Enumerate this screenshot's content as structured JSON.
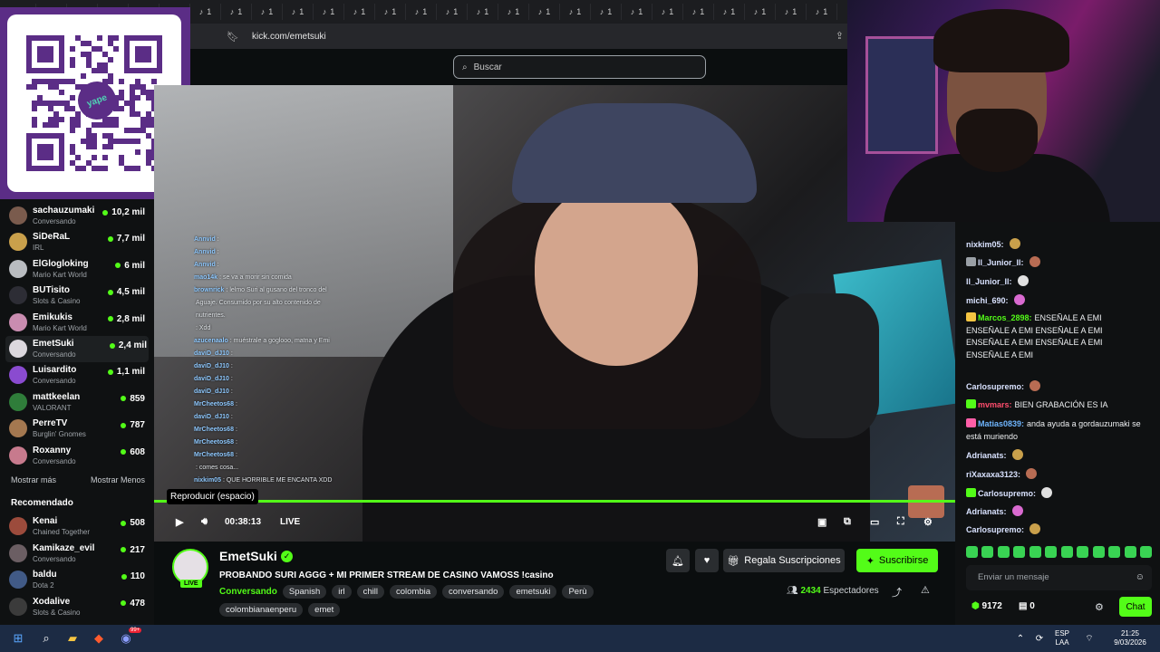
{
  "browser": {
    "url": "kick.com/emetsuki",
    "tab_icon_glyph": "♪",
    "tab_count_text": "1"
  },
  "header": {
    "search_placeholder": "Buscar"
  },
  "qr": {
    "brand": "yape"
  },
  "sidebar": {
    "following": [
      {
        "name": "sachauzumaki",
        "category": "Conversando",
        "viewers": "10,2 mil",
        "color": "#7a5b4d"
      },
      {
        "name": "SiDeRaL",
        "category": "IRL",
        "viewers": "7,7 mil",
        "color": "#c9a04b"
      },
      {
        "name": "ElGlogloking",
        "category": "Mario Kart World",
        "viewers": "6 mil",
        "color": "#b9bcc0"
      },
      {
        "name": "BUTisito",
        "category": "Slots & Casino",
        "viewers": "4,5 mil",
        "color": "#2d2d35"
      },
      {
        "name": "Emikukis",
        "category": "Mario Kart World",
        "viewers": "2,8 mil",
        "color": "#c98cb0"
      },
      {
        "name": "EmetSuki",
        "category": "Conversando",
        "viewers": "2,4 mil",
        "color": "#dcd8de"
      },
      {
        "name": "Luisardito",
        "category": "Conversando",
        "viewers": "1,1 mil",
        "color": "#8a4bd0"
      },
      {
        "name": "mattkeelan",
        "category": "VALORANT",
        "viewers": "859",
        "color": "#2f7d3a"
      },
      {
        "name": "PerreTV",
        "category": "Burglin' Gnomes",
        "viewers": "787",
        "color": "#a47850"
      },
      {
        "name": "Roxanny",
        "category": "Conversando",
        "viewers": "608",
        "color": "#c77a8d"
      }
    ],
    "show_more": "Mostrar más",
    "show_less": "Mostrar Menos",
    "recommended_title": "Recomendado",
    "recommended": [
      {
        "name": "Kenai",
        "category": "Chained Together",
        "viewers": "508",
        "color": "#9c4b3c"
      },
      {
        "name": "Kamikaze_evil",
        "category": "Conversando",
        "viewers": "217",
        "color": "#6b5e63"
      },
      {
        "name": "baldu",
        "category": "Dota 2",
        "viewers": "110",
        "color": "#415a86"
      },
      {
        "name": "Xodalive",
        "category": "Slots & Casino",
        "viewers": "478",
        "color": "#3b3b3b"
      }
    ]
  },
  "video_chat": [
    {
      "user": "Annvid",
      "text": ":"
    },
    {
      "user": "Annvid",
      "text": ":"
    },
    {
      "user": "Annvid",
      "text": ":"
    },
    {
      "user": "mao14k",
      "text": ": se va a morir sin comida"
    },
    {
      "user": "brownrick",
      "text": ": lelmo Suri al gusano del tronco del"
    },
    {
      "user": "",
      "text": "Aguaje. Consumido por su alto contenido de"
    },
    {
      "user": "",
      "text": "nutrientes."
    },
    {
      "user": "",
      "text": ": Xdd"
    },
    {
      "user": "azucenaalo",
      "text": ": muéstrale a goglooo, matna y Emi"
    },
    {
      "user": "daviD_dJ10",
      "text": ":"
    },
    {
      "user": "daviD_dJ10",
      "text": ":"
    },
    {
      "user": "daviD_dJ10",
      "text": ":"
    },
    {
      "user": "daviD_dJ10",
      "text": ":"
    },
    {
      "user": "MrCheetos68",
      "text": ":"
    },
    {
      "user": "daviD_dJ10",
      "text": ":"
    },
    {
      "user": "MrCheetos68",
      "text": ":"
    },
    {
      "user": "MrCheetos68",
      "text": ":"
    },
    {
      "user": "MrCheetos68",
      "text": ":"
    },
    {
      "user": "",
      "text": ": comes cosa..."
    },
    {
      "user": "nixkim05",
      "text": ": QUE HORRIBLE ME ENCANTA XDD"
    }
  ],
  "player": {
    "tooltip": "Reproducir (espacio)",
    "time": "00:38:13",
    "live": "LIVE",
    "progress_pct": 100
  },
  "channel": {
    "name": "EmetSuki",
    "live_badge": "LIVE",
    "title": "PROBANDO SURI AGGG + MI PRIMER STREAM DE CASINO VAMOSS !casino",
    "category": "Conversando",
    "tags": [
      "Spanish",
      "irl",
      "chill",
      "colombia",
      "conversando",
      "emetsuki",
      "Perù"
    ],
    "tags2": [
      "colombianaenperu",
      "emet"
    ],
    "gift_label": "Regala Suscripciones",
    "subscribe_label": "Suscribirse",
    "viewers": "2434",
    "viewers_label": "Espectadores"
  },
  "chat": {
    "messages": [
      {
        "user": "nixkim05:",
        "text": ""
      },
      {
        "user": "Il_Junior_Il:",
        "text": ""
      },
      {
        "user": "Il_Junior_Il:",
        "text": ""
      },
      {
        "user": "michi_690:",
        "text": ""
      },
      {
        "user": "Marcos_2898:",
        "text": "ENSEÑALE A EMI ENSEÑALE A EMI ENSEÑALE A EMI ENSEÑALE A EMI ENSEÑALE A EMI ENSEÑALE A EMI"
      },
      {
        "user": "Carlosupremo:",
        "text": ""
      },
      {
        "user": "mvmars:",
        "text": "BIEN GRABACIÓN ES IA"
      },
      {
        "user": "Matias0839:",
        "text": "anda ayuda a gordauzumaki se está muriendo"
      },
      {
        "user": "Adrianats:",
        "text": ""
      },
      {
        "user": "riXaxaxa3123:",
        "text": ""
      },
      {
        "user": "Carlosupremo:",
        "text": ""
      },
      {
        "user": "Adrianats:",
        "text": ""
      },
      {
        "user": "Carlosupremo:",
        "text": ""
      }
    ],
    "input_placeholder": "Enviar un mensaje",
    "points": "9172",
    "points2": "0",
    "chat_button": "Chat"
  },
  "taskbar": {
    "lang": "ESP",
    "lang2": "LAA",
    "time": "21:25",
    "date": "9/03/2026",
    "discord_badge": "99+"
  },
  "colors": {
    "accent": "#53fc18",
    "qr_bg": "#5b2d86",
    "taskbar": "#1c2b44"
  }
}
